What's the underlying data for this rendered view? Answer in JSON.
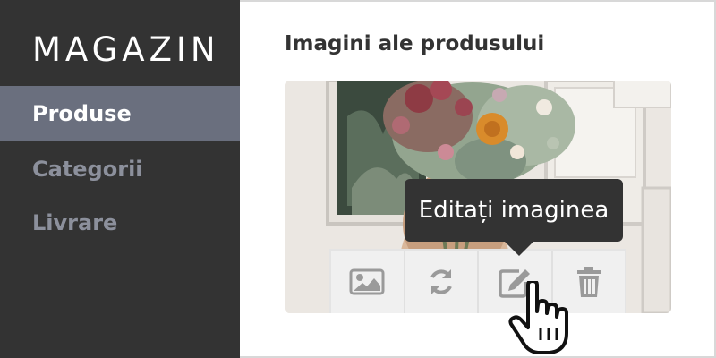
{
  "sidebar": {
    "brand": "MAGAZIN",
    "items": [
      {
        "label": "Produse",
        "active": true
      },
      {
        "label": "Categorii",
        "active": false
      },
      {
        "label": "Livrare",
        "active": false
      }
    ]
  },
  "main": {
    "title": "Imagini ale produsului",
    "image": {
      "alt": "flower-bouquet-photo"
    },
    "toolbar": {
      "buttons": [
        {
          "icon": "image-icon"
        },
        {
          "icon": "refresh-icon"
        },
        {
          "icon": "edit-icon"
        },
        {
          "icon": "trash-icon"
        }
      ]
    },
    "tooltip": "Editați imaginea"
  },
  "colors": {
    "sidebar_bg": "#333333",
    "active_item_bg": "#6a6f7e",
    "inactive_item_text": "#8c909c",
    "icon_gray": "#9a9a9a"
  }
}
